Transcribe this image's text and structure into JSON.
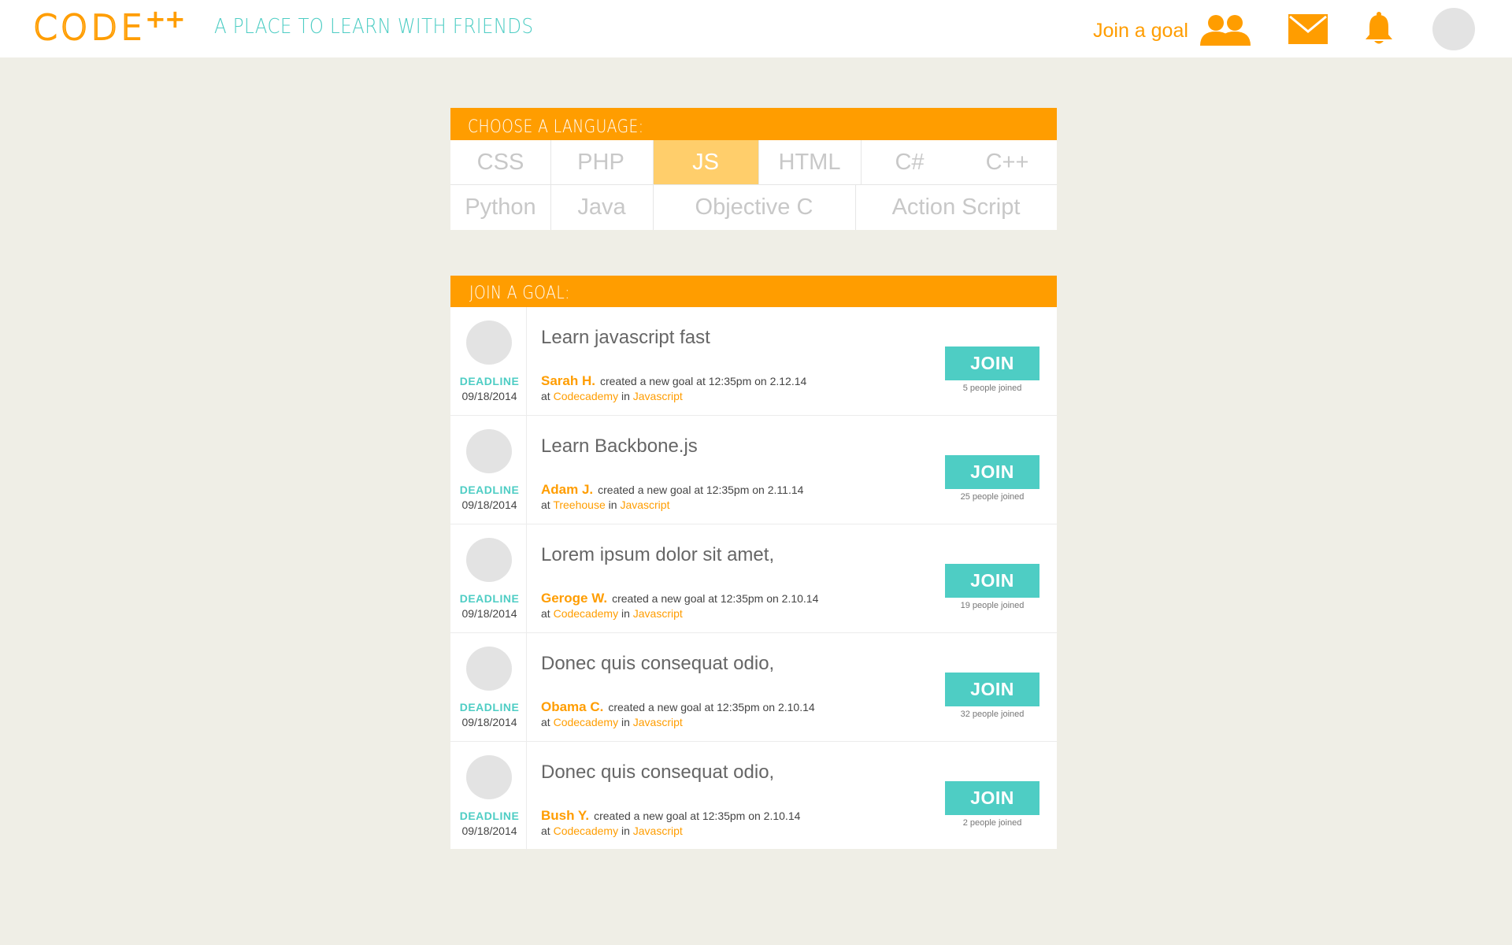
{
  "header": {
    "logo_text": "CODE",
    "logo_plus": "++",
    "tagline": "A PLACE TO LEARN WITH FRIENDS",
    "join_goal_label": "Join a goal",
    "icons": [
      "people-icon",
      "mail-icon",
      "bell-icon",
      "avatar"
    ],
    "accent_color": "#ff9d00",
    "teal_color": "#4ecdc4"
  },
  "languages": {
    "title": "CHOOSE A LANGUAGE:",
    "row1": [
      "CSS",
      "PHP",
      "JS",
      "HTML",
      "C#",
      "C++"
    ],
    "row2": [
      "Python",
      "Java",
      "Objective C",
      "Action Script"
    ],
    "selected": "JS"
  },
  "goals": {
    "title": "JOIN A GOAL:",
    "deadline_label": "DEADLINE",
    "join_label": "JOIN",
    "items": [
      {
        "title": "Learn javascript fast",
        "author": "Sarah H.",
        "action": "created a new goal at 12:35pm on 2.12.14",
        "at": "at",
        "place": "Codecademy",
        "in": "in",
        "language": "Javascript",
        "deadline": "09/18/2014",
        "joined": "5 people joined"
      },
      {
        "title": "Learn Backbone.js",
        "author": "Adam J.",
        "action": "created a new goal at 12:35pm on 2.11.14",
        "at": "at",
        "place": "Treehouse",
        "in": "in",
        "language": "Javascript",
        "deadline": "09/18/2014",
        "joined": "25 people joined"
      },
      {
        "title": "Lorem ipsum dolor sit amet,",
        "author": "Geroge W.",
        "action": "created a new goal at 12:35pm on 2.10.14",
        "at": "at",
        "place": "Codecademy",
        "in": "in",
        "language": "Javascript",
        "deadline": "09/18/2014",
        "joined": "19 people joined"
      },
      {
        "title": "Donec quis consequat odio,",
        "author": "Obama C.",
        "action": "created a new goal at 12:35pm on 2.10.14",
        "at": "at",
        "place": "Codecademy",
        "in": "in",
        "language": "Javascript",
        "deadline": "09/18/2014",
        "joined": "32 people joined"
      },
      {
        "title": "Donec quis consequat odio,",
        "author": "Bush Y.",
        "action": "created a new goal at 12:35pm on 2.10.14",
        "at": "at",
        "place": "Codecademy",
        "in": "in",
        "language": "Javascript",
        "deadline": "09/18/2014",
        "joined": "2 people joined"
      }
    ]
  }
}
